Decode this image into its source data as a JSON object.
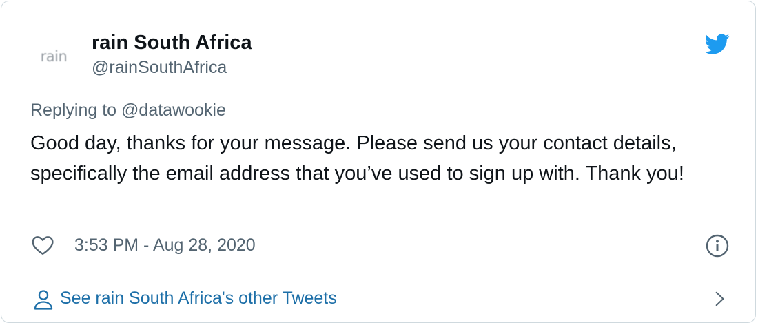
{
  "author": {
    "avatar_text": "rain",
    "display_name": "rain South Africa",
    "handle": "@rainSouthAfrica"
  },
  "tweet": {
    "replying_to_prefix": "Replying to ",
    "replying_to_handle": "@datawookie",
    "text": "Good day, thanks for your message. Please send us your contact details, specifically the email address that you’ve used to sign up with. Thank you!",
    "timestamp": "3:53 PM - Aug 28, 2020"
  },
  "footer": {
    "other_tweets_label": "See rain South Africa's other Tweets"
  },
  "icons": {
    "brand": "twitter-bird-icon",
    "like": "heart-icon",
    "info": "info-icon",
    "profile": "person-icon",
    "navigate": "chevron-right-icon"
  },
  "colors": {
    "twitter_blue": "#1d9bf0",
    "link_blue": "#1d6fa8",
    "text_primary": "#0f1419",
    "text_secondary": "#536471",
    "border": "#cfd9de"
  }
}
